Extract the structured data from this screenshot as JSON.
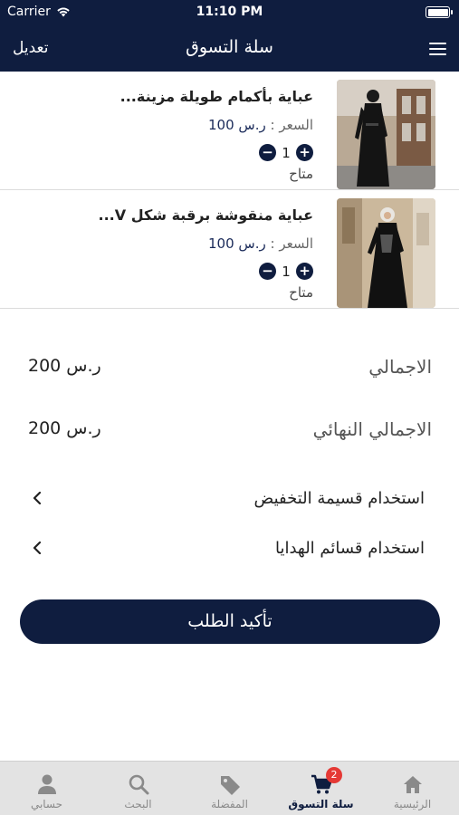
{
  "status_bar": {
    "carrier": "Carrier",
    "time": "11:10 PM"
  },
  "nav": {
    "title": "سلة التسوق",
    "edit_label": "تعديل"
  },
  "items": [
    {
      "name": "عباية بأكمام طويلة مزينة...",
      "price_label": "السعر :",
      "price_value": "ر.س 100",
      "quantity": "1",
      "stock": "متاح"
    },
    {
      "name": "عباية منقوشة برقبة شكل V...",
      "price_label": "السعر :",
      "price_value": "ر.س 100",
      "quantity": "1",
      "stock": "متاح"
    }
  ],
  "summary": {
    "total_label": "الاجمالي",
    "total_value": "ر.س 200",
    "final_label": "الاجمالي النهائي",
    "final_value": "ر.س 200"
  },
  "options": {
    "discount": "استخدام قسيمة التخفيض",
    "gift": "استخدام قسائم الهدايا"
  },
  "confirm_label": "تأكيد الطلب",
  "tabs": [
    {
      "label": "الرئيسية",
      "icon": "home-icon"
    },
    {
      "label": "سلة التسوق",
      "icon": "cart-icon",
      "badge": "2",
      "active": true
    },
    {
      "label": "المفضلة",
      "icon": "tag-icon"
    },
    {
      "label": "البحث",
      "icon": "search-icon"
    },
    {
      "label": "حسابي",
      "icon": "person-icon"
    }
  ],
  "colors": {
    "primary": "#0f1d3f",
    "badge": "#e53935",
    "tabbar_bg": "#e3e3e3"
  }
}
